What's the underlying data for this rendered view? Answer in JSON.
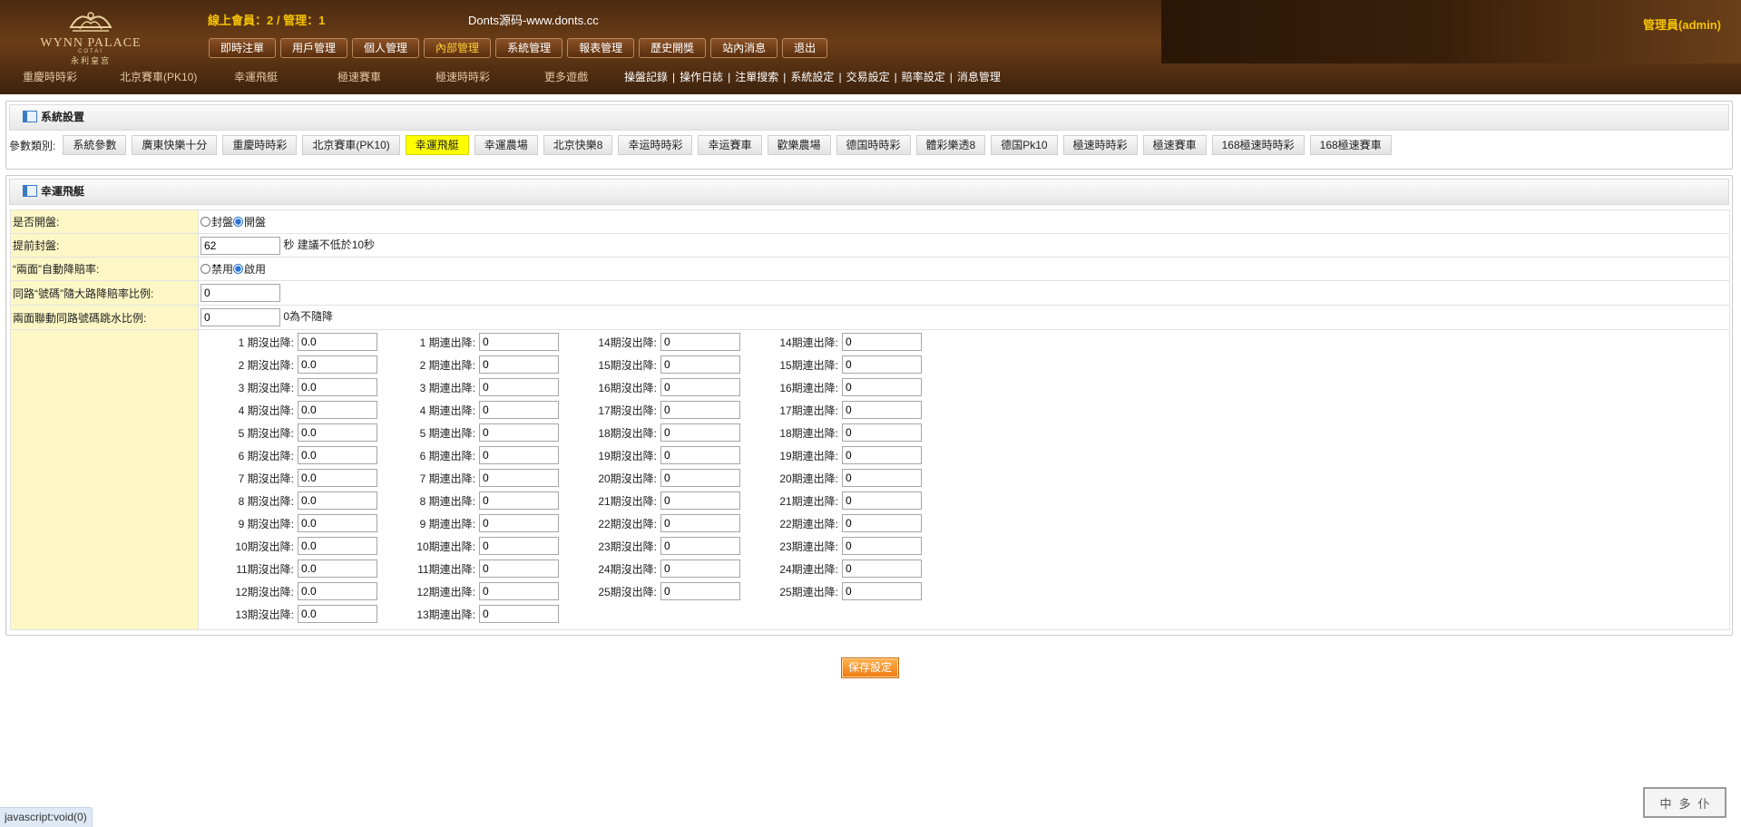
{
  "header": {
    "logo": {
      "line1": "WYNN PALACE",
      "line2": "COTAI",
      "line3": "永利皇宫"
    },
    "online_text": "線上會員：2 / 管理：1",
    "site_title": "Donts源码-www.donts.cc",
    "admin_text": "管理員(admin)",
    "nav": [
      "即時注單",
      "用戶管理",
      "個人管理",
      "內部管理",
      "系統管理",
      "報表管理",
      "歷史開獎",
      "站內消息",
      "退出"
    ],
    "active_nav": "內部管理",
    "games": [
      "重慶時時彩",
      "北京賽車(PK10)",
      "幸運飛艇",
      "極速賽車",
      "極速時時彩",
      "更多遊戲"
    ],
    "links": [
      "操盤記錄",
      "操作日誌",
      "注單搜索",
      "系統設定",
      "交易設定",
      "賠率設定",
      "消息管理"
    ]
  },
  "settings_panel": {
    "title": "系統設置",
    "param_label": "參數類別:",
    "categories": [
      "系統參數",
      "廣東快樂十分",
      "重慶時時彩",
      "北京賽車(PK10)",
      "幸運飛艇",
      "幸運農場",
      "北京快樂8",
      "幸运時時彩",
      "幸运賽車",
      "歡樂農場",
      "德国時時彩",
      "體彩樂透8",
      "德国Pk10",
      "極速時時彩",
      "極速賽車",
      "168極速時時彩",
      "168極速賽車"
    ],
    "active_category": "幸運飛艇"
  },
  "form_panel": {
    "title": "幸運飛艇",
    "open_label": "是否開盤:",
    "open_options": [
      "封盤",
      "開盤"
    ],
    "open_selected": "開盤",
    "close_ahead_label": "提前封盤:",
    "close_ahead_value": "62",
    "close_ahead_unit": "秒",
    "close_ahead_hint": "建議不低於10秒",
    "auto_odds_label": "“兩面”自動降賠率:",
    "auto_odds_options": [
      "禁用",
      "啟用"
    ],
    "auto_odds_selected": "啟用",
    "same_road_label": "同路“號碼”隨大路降賠率比例:",
    "same_road_value": "0",
    "linkage_label": "兩面聯動同路號碼跳水比例:",
    "linkage_value": "0",
    "linkage_hint": "0為不隨降",
    "col1": [
      {
        "label": "1 期沒出降:",
        "value": "0.0"
      },
      {
        "label": "2 期沒出降:",
        "value": "0.0"
      },
      {
        "label": "3 期沒出降:",
        "value": "0.0"
      },
      {
        "label": "4 期沒出降:",
        "value": "0.0"
      },
      {
        "label": "5 期沒出降:",
        "value": "0.0"
      },
      {
        "label": "6 期沒出降:",
        "value": "0.0"
      },
      {
        "label": "7 期沒出降:",
        "value": "0.0"
      },
      {
        "label": "8 期沒出降:",
        "value": "0.0"
      },
      {
        "label": "9 期沒出降:",
        "value": "0.0"
      },
      {
        "label": "10期沒出降:",
        "value": "0.0"
      },
      {
        "label": "11期沒出降:",
        "value": "0.0"
      },
      {
        "label": "12期沒出降:",
        "value": "0.0"
      },
      {
        "label": "13期沒出降:",
        "value": "0.0"
      }
    ],
    "col2": [
      {
        "label": "1 期連出降:",
        "value": "0"
      },
      {
        "label": "2 期連出降:",
        "value": "0"
      },
      {
        "label": "3 期連出降:",
        "value": "0"
      },
      {
        "label": "4 期連出降:",
        "value": "0"
      },
      {
        "label": "5 期連出降:",
        "value": "0"
      },
      {
        "label": "6 期連出降:",
        "value": "0"
      },
      {
        "label": "7 期連出降:",
        "value": "0"
      },
      {
        "label": "8 期連出降:",
        "value": "0"
      },
      {
        "label": "9 期連出降:",
        "value": "0"
      },
      {
        "label": "10期連出降:",
        "value": "0"
      },
      {
        "label": "11期連出降:",
        "value": "0"
      },
      {
        "label": "12期連出降:",
        "value": "0"
      },
      {
        "label": "13期連出降:",
        "value": "0"
      }
    ],
    "col3": [
      {
        "label": "14期沒出降:",
        "value": "0"
      },
      {
        "label": "15期沒出降:",
        "value": "0"
      },
      {
        "label": "16期沒出降:",
        "value": "0"
      },
      {
        "label": "17期沒出降:",
        "value": "0"
      },
      {
        "label": "18期沒出降:",
        "value": "0"
      },
      {
        "label": "19期沒出降:",
        "value": "0"
      },
      {
        "label": "20期沒出降:",
        "value": "0"
      },
      {
        "label": "21期沒出降:",
        "value": "0"
      },
      {
        "label": "22期沒出降:",
        "value": "0"
      },
      {
        "label": "23期沒出降:",
        "value": "0"
      },
      {
        "label": "24期沒出降:",
        "value": "0"
      },
      {
        "label": "25期沒出降:",
        "value": "0"
      }
    ],
    "col4": [
      {
        "label": "14期連出降:",
        "value": "0"
      },
      {
        "label": "15期連出降:",
        "value": "0"
      },
      {
        "label": "16期連出降:",
        "value": "0"
      },
      {
        "label": "17期連出降:",
        "value": "0"
      },
      {
        "label": "18期連出降:",
        "value": "0"
      },
      {
        "label": "19期連出降:",
        "value": "0"
      },
      {
        "label": "20期連出降:",
        "value": "0"
      },
      {
        "label": "21期連出降:",
        "value": "0"
      },
      {
        "label": "22期連出降:",
        "value": "0"
      },
      {
        "label": "23期連出降:",
        "value": "0"
      },
      {
        "label": "24期連出降:",
        "value": "0"
      },
      {
        "label": "25期連出降:",
        "value": "0"
      }
    ]
  },
  "save_label": "保存設定",
  "status_text": "javascript:void(0)",
  "stamp_text": [
    "中",
    "多",
    "仆"
  ]
}
